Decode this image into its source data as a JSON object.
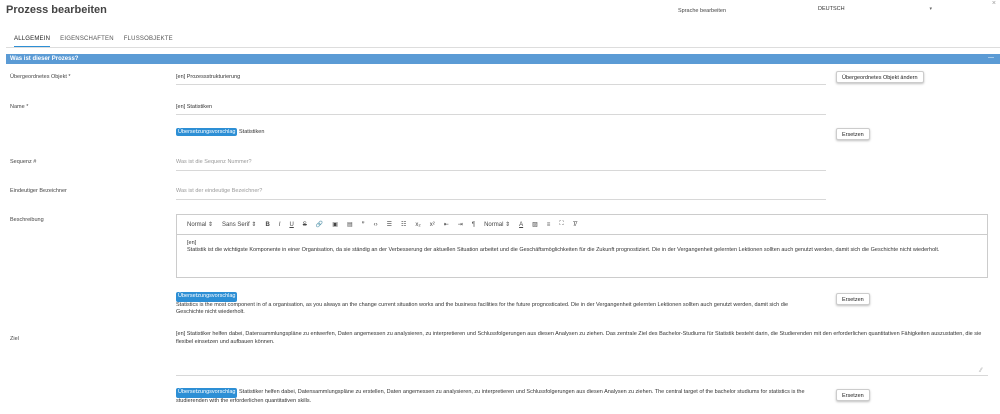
{
  "header": {
    "title": "Prozess bearbeiten",
    "close": "×",
    "language_label": "Sprache bearbeiten",
    "language_value": "DEUTSCH",
    "caret": "▾"
  },
  "tabs": [
    {
      "label": "ALLGEMEIN"
    },
    {
      "label": "EIGENSCHAFTEN"
    },
    {
      "label": "FLUSSOBJEKTE"
    }
  ],
  "section": {
    "title": "Was ist dieser Prozess?",
    "collapse": "—"
  },
  "fields": {
    "parent": {
      "label": "Übergeordnetes Objekt *",
      "value": "[en] Prozessstrukturierung",
      "button": "Übergeordnetes Objekt ändern"
    },
    "name": {
      "label": "Name *",
      "value": "[en] Statistiken",
      "suggestion_badge": "Übersetzungsvorschlag",
      "suggestion_text": "Statistiken",
      "button": "Ersetzen"
    },
    "sequence": {
      "label": "Sequenz #",
      "placeholder": "Was ist die Sequenz Nummer?"
    },
    "identifier": {
      "label": "Eindeutiger Bezeichner",
      "placeholder": "Was ist der eindeutige Bezeichner?"
    },
    "description": {
      "label": "Beschreibung",
      "toolbar": {
        "format": "Normal",
        "font": "Sans Serif",
        "size": "Normal",
        "arrow": "⇕"
      },
      "content_line1": "[en]",
      "content_line2": "Statistik ist die wichtigste Komponente in einer Organisation, da sie ständig an der Verbesserung der aktuellen Situation arbeitet und die Geschäftsmöglichkeiten für die Zukunft prognostiziert. Die in der Vergangenheit gelernten Lektionen sollten auch genutzt werden, damit sich die Geschichte nicht wiederholt.",
      "suggestion_badge": "Übersetzungsvorschlag",
      "suggestion_text": "Statistics is the most component in of a organisation, as you always an the change current situation works and the business facilities for the future prognosticated. Die in der Vergangenheit gelernten Lektionen sollten auch genutzt werden, damit sich die Geschichte nicht wiederholt.",
      "button": "Ersetzen"
    },
    "goal": {
      "label": "Ziel",
      "value": "[en] Statistiker helfen dabei, Datensammlungspläne zu entwerfen, Daten angemessen zu analysieren, zu interpretieren und Schlussfolgerungen aus diesen Analysen zu ziehen. Das zentrale Ziel des Bachelor-Studiums für Statistik besteht darin, die Studierenden mit den erforderlichen quantitativen Fähigkeiten auszustatten, die sie flexibel einsetzen und aufbauen können.",
      "suggestion_badge": "Übersetzungsvorschlag",
      "suggestion_text": "Statistiker helfen dabei, Datensammlungspläne zu erstellen, Daten angemessen zu analysieren, zu interpretieren und Schlussfolgerungen aus diesen Analysen zu ziehen. The central target of the bachelor studiums for statistics is the studierenden with the erforderlichen quantitativen skills.",
      "button": "Ersetzen"
    }
  }
}
